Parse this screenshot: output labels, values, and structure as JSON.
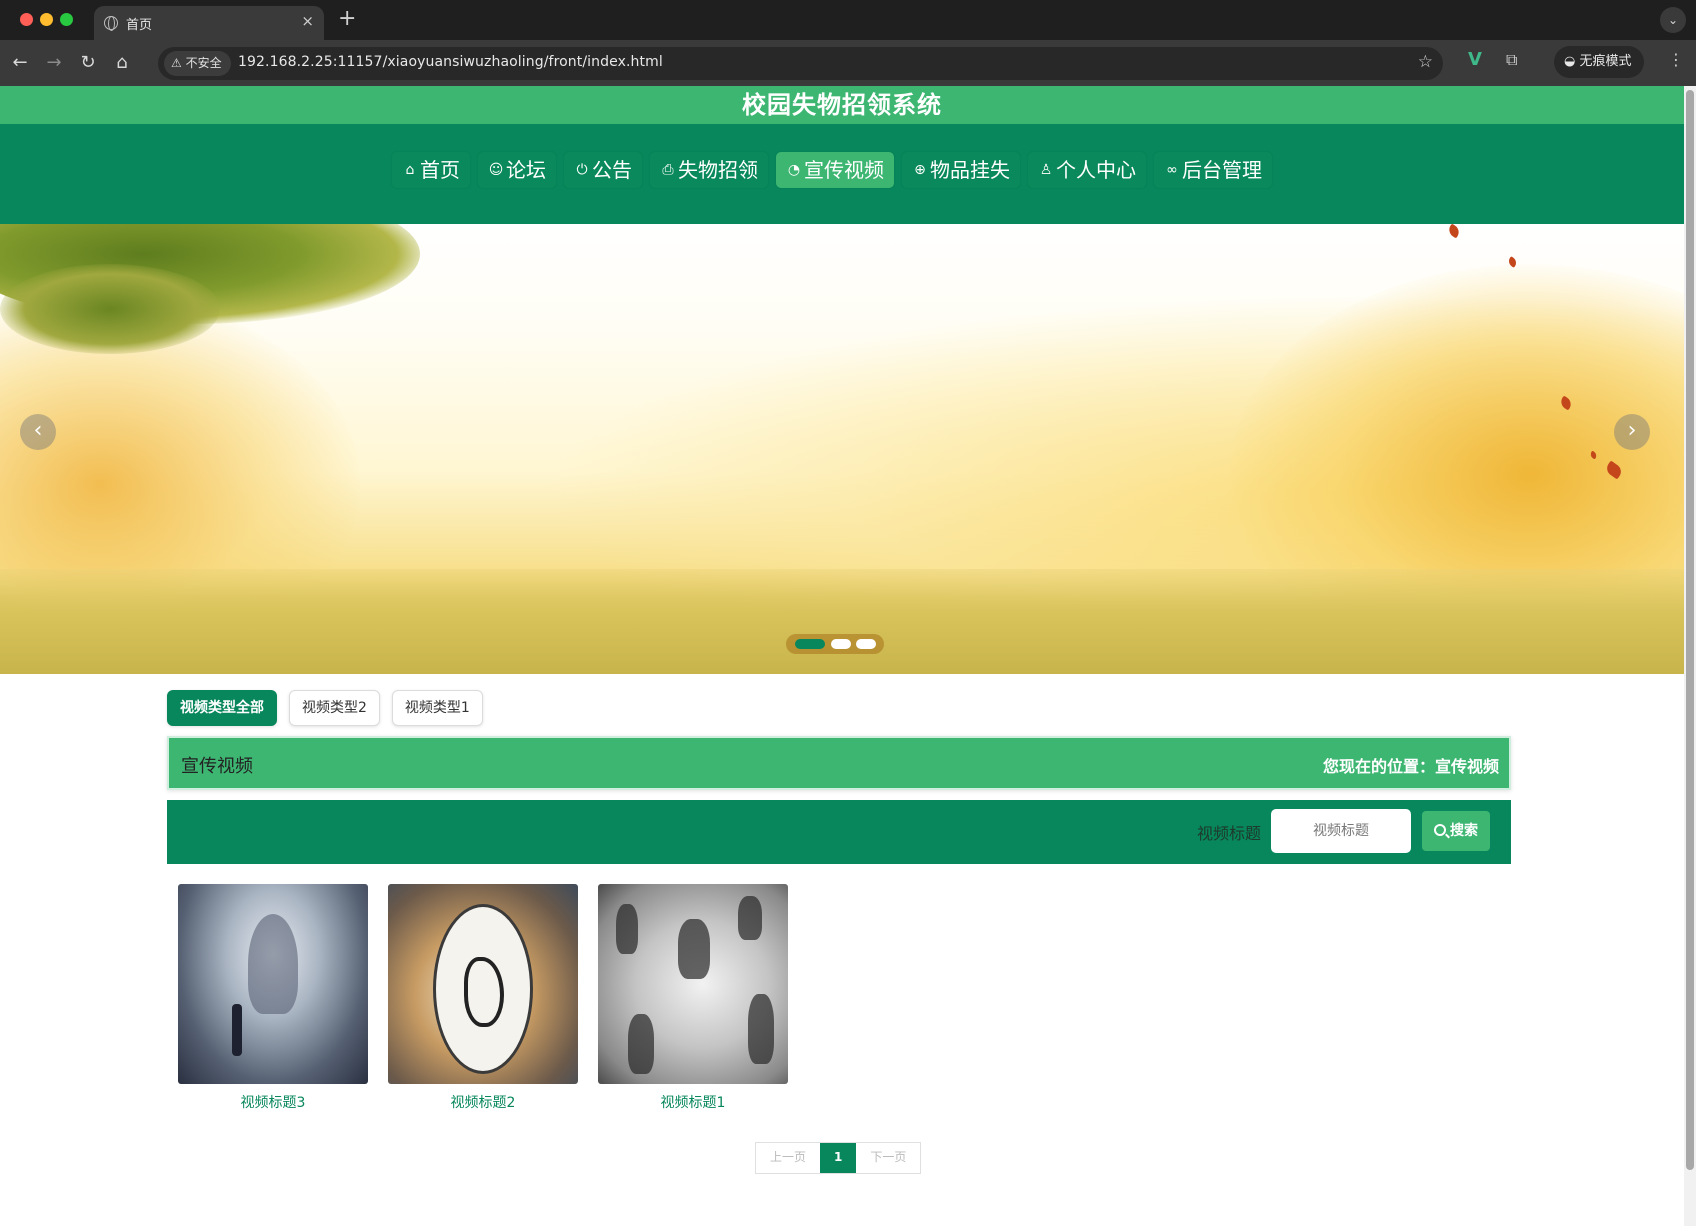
{
  "browser": {
    "tab_title": "首页",
    "tab_close": "×",
    "new_tab": "+",
    "url": "192.168.2.25:11157/xiaoyuansiwuzhaoling/front/index.html",
    "security_label": "不安全",
    "incognito_label": "无痕模式"
  },
  "site": {
    "title": "校园失物招领系统"
  },
  "nav": {
    "items": [
      {
        "label": "首页",
        "icon": "home-icon"
      },
      {
        "label": "论坛",
        "icon": "forum-icon"
      },
      {
        "label": "公告",
        "icon": "power-icon"
      },
      {
        "label": "失物招领",
        "icon": "printer-icon"
      },
      {
        "label": "宣传视频",
        "icon": "gauge-icon",
        "active": true
      },
      {
        "label": "物品挂失",
        "icon": "globe-icon"
      },
      {
        "label": "个人中心",
        "icon": "user-icon"
      },
      {
        "label": "后台管理",
        "icon": "link-icon"
      }
    ]
  },
  "carousel": {
    "slide_count": 3,
    "active_index": 0
  },
  "categories": [
    {
      "label": "视频类型全部",
      "active": true
    },
    {
      "label": "视频类型2",
      "active": false
    },
    {
      "label": "视频类型1",
      "active": false
    }
  ],
  "page_header": {
    "title": "宣传视频",
    "location": "您现在的位置：宣传视频"
  },
  "search": {
    "label": "视频标题",
    "placeholder": "视频标题",
    "button_label": "搜索"
  },
  "videos": [
    {
      "title": "视频标题3"
    },
    {
      "title": "视频标题2"
    },
    {
      "title": "视频标题1"
    }
  ],
  "pagination": {
    "prev_label": "上一页",
    "current_page": "1",
    "next_label": "下一页"
  },
  "colors": {
    "brand_dark": "#07875b",
    "brand_light": "#3db672"
  }
}
